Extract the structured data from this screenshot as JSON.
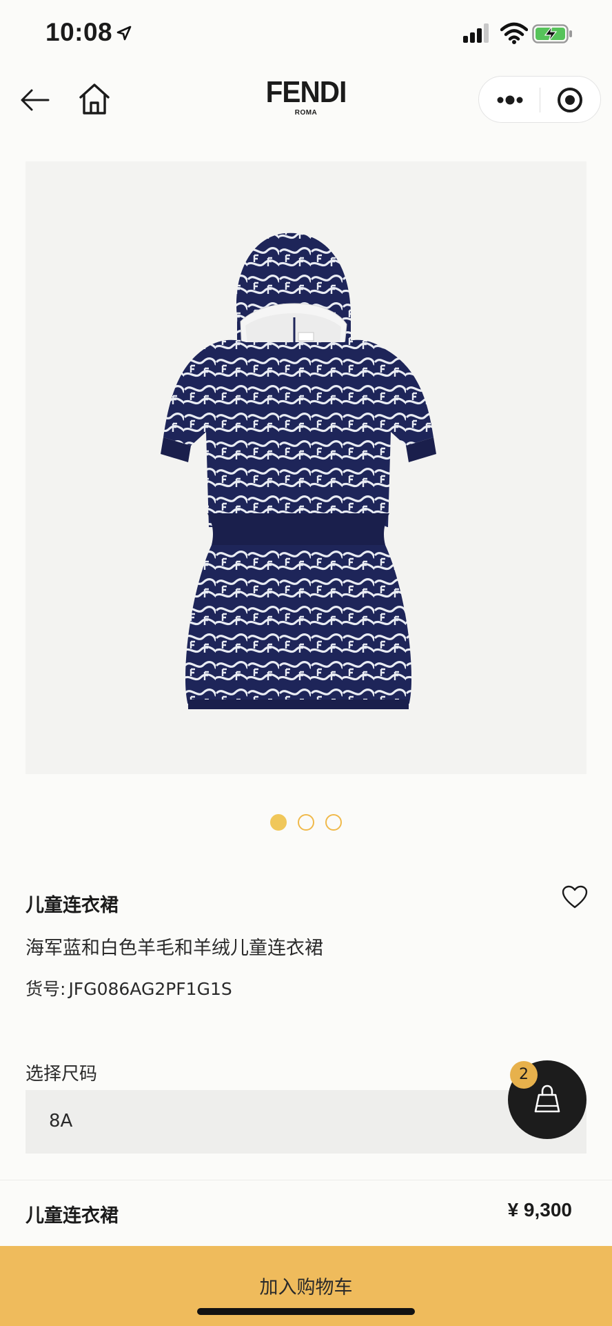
{
  "status_bar": {
    "time": "10:08",
    "icons": [
      "location-arrow-icon",
      "signal-icon",
      "wifi-icon",
      "battery-charging-icon"
    ]
  },
  "nav": {
    "brand": "FENDI",
    "brand_sub": "ROMA",
    "icons": [
      "back-arrow-icon",
      "home-icon",
      "more-dots-icon",
      "target-icon"
    ]
  },
  "gallery": {
    "image_count": 3,
    "active_index": 0,
    "colors": {
      "active_dot": "#f0c75a",
      "garment_navy": "#1e2559"
    }
  },
  "product": {
    "title": "儿童连衣裙",
    "description": "海军蓝和白色羊毛和羊绒儿童连衣裙",
    "sku_label": "货号:",
    "sku_value": "JFG086AG2PF1G1S",
    "favorite_icon": "heart-outline-icon"
  },
  "size": {
    "label": "选择尺码",
    "selected": "8A"
  },
  "cart": {
    "badge_count": "2",
    "icon": "shopping-bag-icon"
  },
  "summary": {
    "name": "儿童连衣裙",
    "price": "¥ 9,300"
  },
  "cta": {
    "label": "加入购物车",
    "color": "#efbb5c"
  }
}
